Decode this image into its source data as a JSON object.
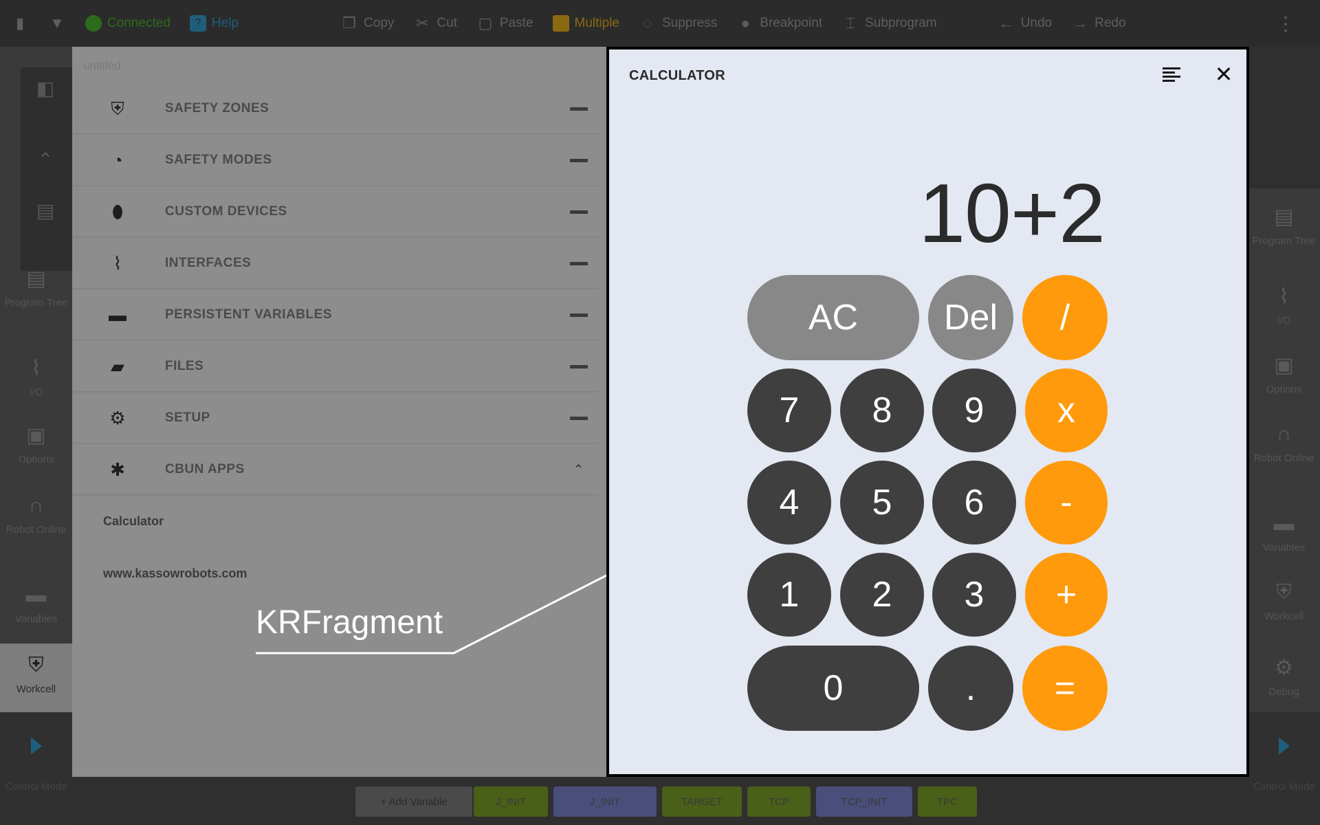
{
  "toolbar": {
    "connected": "Connected",
    "help": "Help",
    "copy": "Copy",
    "cut": "Cut",
    "paste": "Paste",
    "multiple": "Multiple",
    "suppress": "Suppress",
    "breakpoint": "Breakpoint",
    "subprogram": "Subprogram",
    "undo": "Undo",
    "redo": "Redo",
    "colors": {
      "connected": "#2e6b1c",
      "help": "#1f5e7a",
      "multiple": "#8a6a10"
    }
  },
  "left_rail": {
    "items": [
      {
        "label": "Program Tree",
        "icon": "program-tree-icon"
      },
      {
        "label": "I/O",
        "icon": "io-icon"
      },
      {
        "label": "Options",
        "icon": "options-icon"
      },
      {
        "label": "Robot Online",
        "icon": "robot-online-icon"
      },
      {
        "label": "Variables",
        "icon": "variables-icon"
      },
      {
        "label": "Workcell",
        "icon": "workcell-icon"
      }
    ],
    "control_mode": "Control Mode"
  },
  "right_rail": {
    "items": [
      {
        "label": "Program Tree",
        "icon": "program-tree-icon"
      },
      {
        "label": "I/O",
        "icon": "io-icon"
      },
      {
        "label": "Options",
        "icon": "options-icon"
      },
      {
        "label": "Robot Online",
        "icon": "robot-online-icon"
      },
      {
        "label": "Variables",
        "icon": "variables-icon"
      },
      {
        "label": "Workcell",
        "icon": "workcell-icon"
      },
      {
        "label": "Debug",
        "icon": "debug-icon"
      }
    ],
    "control_mode": "Control Mode"
  },
  "side_panel": {
    "title": "untitled",
    "items": [
      {
        "label": "SAFETY ZONES",
        "icon": "shield-icon"
      },
      {
        "label": "SAFETY MODES",
        "icon": "gauge-icon"
      },
      {
        "label": "CUSTOM DEVICES",
        "icon": "device-icon"
      },
      {
        "label": "INTERFACES",
        "icon": "interfaces-icon"
      },
      {
        "label": "PERSISTENT VARIABLES",
        "icon": "briefcase-icon"
      },
      {
        "label": "FILES",
        "icon": "folder-icon"
      },
      {
        "label": "SETUP",
        "icon": "gear-icon"
      },
      {
        "label": "CBUN APPS",
        "icon": "puzzle-icon"
      }
    ],
    "sub_items": [
      "Calculator",
      "www.kassowrobots.com"
    ]
  },
  "bottom_bar": {
    "add_variable": "+ Add Variable",
    "chips": [
      "J_INIT",
      "J_INIT",
      "TARGET",
      "TCP",
      "TCP_INIT",
      "TPC"
    ]
  },
  "callout": {
    "label": "KRFragment"
  },
  "calculator": {
    "title": "CALCULATOR",
    "display": "10+2",
    "keys": {
      "ac": "AC",
      "del": "Del",
      "divide": "/",
      "seven": "7",
      "eight": "8",
      "nine": "9",
      "multiply": "x",
      "four": "4",
      "five": "5",
      "six": "6",
      "minus": "-",
      "one": "1",
      "two": "2",
      "three": "3",
      "plus": "+",
      "zero": "0",
      "dot": ".",
      "equals": "="
    },
    "colors": {
      "operator": "#ff9a0c",
      "digit": "#3f3f3f",
      "function": "#888888",
      "background": "#e3e8f2"
    }
  }
}
